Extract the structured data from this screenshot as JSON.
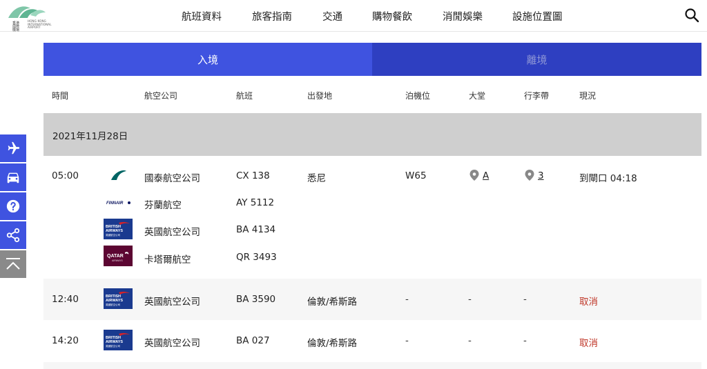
{
  "header": {
    "logo": {
      "cn": "香港國際機場",
      "en": "HONG KONG INTERNATIONAL AIRPORT"
    },
    "nav": [
      "航班資料",
      "旅客指南",
      "交通",
      "購物餐飲",
      "消閒娛樂",
      "設施位置圖"
    ]
  },
  "tabs": {
    "arrival": "入境",
    "departure": "離境"
  },
  "columns": {
    "time": "時間",
    "airline": "航空公司",
    "flight": "航班",
    "origin": "出發地",
    "stand": "泊機位",
    "hall": "大堂",
    "belt": "行李帶",
    "status": "現況"
  },
  "date": "2021年11月28日",
  "flights": [
    {
      "time": "05:00",
      "origin": "悉尼",
      "stand": "W65",
      "hall": "A",
      "belt": "3",
      "status": "到閘口 04:18",
      "carriers": [
        {
          "airline": "國泰航空公司",
          "flight": "CX 138",
          "logo": "cathay-logo"
        },
        {
          "airline": "芬蘭航空",
          "flight": "AY 5112",
          "logo": "finnair-logo"
        },
        {
          "airline": "英國航空公司",
          "flight": "BA 4134",
          "logo": "british-airways-logo"
        },
        {
          "airline": "卡塔爾航空",
          "flight": "QR 3493",
          "logo": "qatar-logo"
        }
      ]
    },
    {
      "time": "12:40",
      "origin": "倫敦/希斯路",
      "stand": "-",
      "hall": "-",
      "belt": "-",
      "status": "取消",
      "carriers": [
        {
          "airline": "英國航空公司",
          "flight": "BA 3590",
          "logo": "british-airways-logo"
        }
      ]
    },
    {
      "time": "14:20",
      "origin": "倫敦/希斯路",
      "stand": "-",
      "hall": "-",
      "belt": "-",
      "status": "取消",
      "carriers": [
        {
          "airline": "英國航空公司",
          "flight": "BA 027",
          "logo": "british-airways-logo"
        }
      ]
    }
  ],
  "logos": {
    "finnair": "FINNAIR",
    "british_airways": [
      "BRITISH",
      "AIRWAYS",
      "英國航空公司"
    ],
    "qatar": [
      "QATAR",
      "AIRWAYS"
    ]
  },
  "side_tools": [
    "plane-icon",
    "taxi-icon",
    "help-icon",
    "share-icon",
    "back-to-top-icon"
  ],
  "colors": {
    "accent": "#3f53e0",
    "tab_inactive": "#2e3fc1",
    "cancel": "#c0392b",
    "date_band": "#cfcfcf"
  }
}
